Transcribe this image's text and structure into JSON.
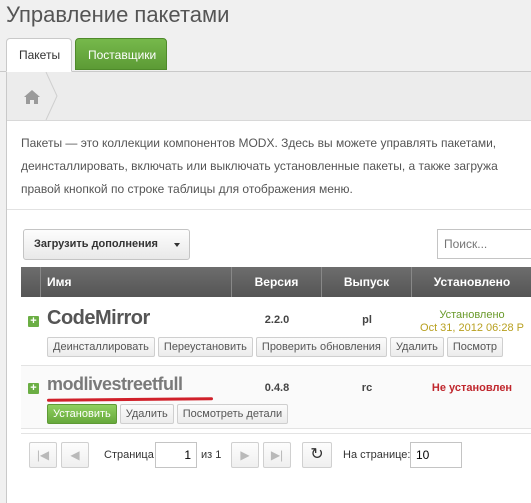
{
  "page_title": "Управление пакетами",
  "tabs": [
    {
      "label": "Пакеты",
      "active": true
    },
    {
      "label": "Поставщики",
      "active": false
    }
  ],
  "breadcrumb": {
    "home_icon": "home-icon"
  },
  "description": "Пакеты — это коллекции компонентов MODX. Здесь вы можете управлять пакетами,\nдеинсталлировать, включать или выключать установленные пакеты, а также загружа\nправой кнопкой по строке таблицы для отображения меню.",
  "toolbar": {
    "load_label": "Загрузить дополнения",
    "search_placeholder": "Поиск..."
  },
  "grid": {
    "columns": [
      "Имя",
      "Версия",
      "Выпуск",
      "Установлено"
    ],
    "rows": [
      {
        "name": "CodeMirror",
        "version": "2.2.0",
        "release": "pl",
        "status": "Установлено",
        "date": "Oct 31, 2012 06:28 P",
        "actions": [
          "Деинсталлировать",
          "Переустановить",
          "Проверить обновления",
          "Удалить",
          "Посмотр"
        ]
      },
      {
        "name": "modlivestreetfull",
        "version": "0.4.8",
        "release": "rc",
        "status": "Не установлен",
        "actions": [
          "Установить",
          "Удалить",
          "Посмотреть детали"
        ]
      }
    ]
  },
  "pager": {
    "page_label": "Страница",
    "page_value": "1",
    "of_label": "из 1",
    "per_page_label": "На странице:",
    "per_page_value": "10"
  },
  "colors": {
    "accent_green": "#67a93c",
    "error_red": "#c0272d",
    "header_gray": "#5f5f5f"
  }
}
